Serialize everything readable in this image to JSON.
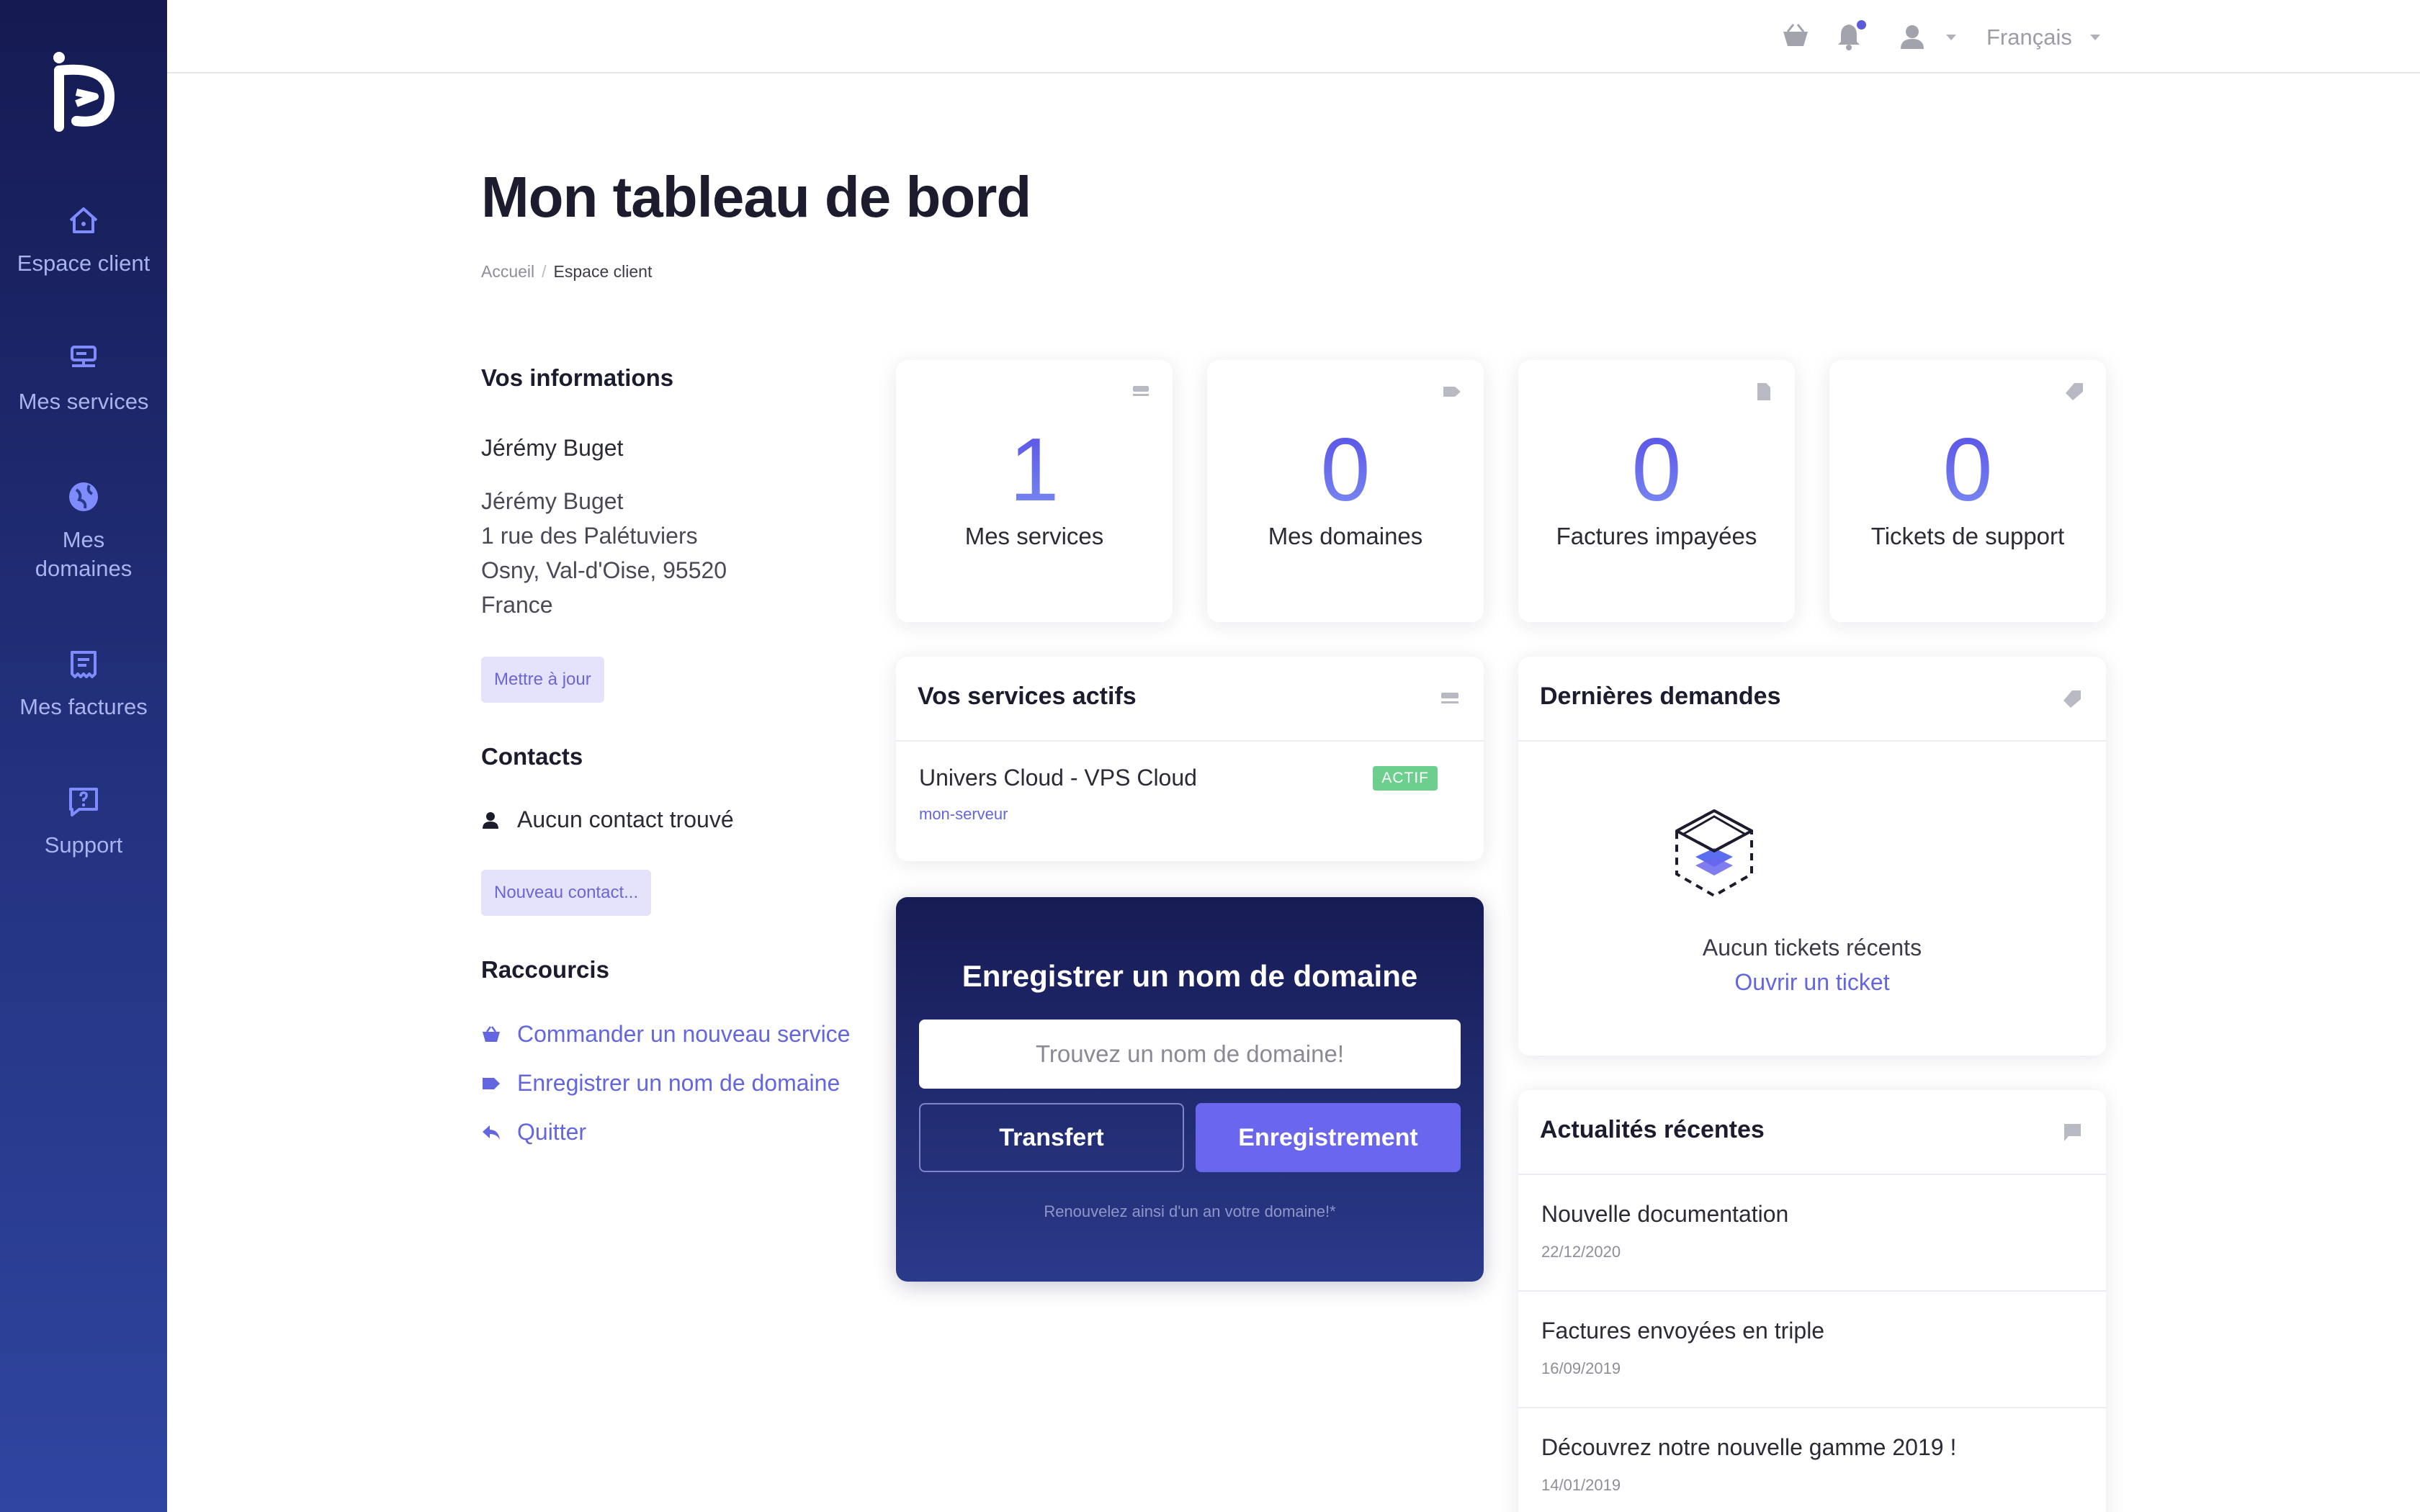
{
  "colors": {
    "sidebar_top": "#151a52",
    "sidebar_bottom": "#2f45a0",
    "accent": "#6366e0",
    "badge_green": "#6ccf8e"
  },
  "sidebar": {
    "items": [
      {
        "label": "Espace client",
        "icon": "home-icon"
      },
      {
        "label": "Mes services",
        "icon": "server-icon"
      },
      {
        "label": "Mes domaines",
        "icon": "globe-icon"
      },
      {
        "label": "Mes factures",
        "icon": "invoice-icon"
      },
      {
        "label": "Support",
        "icon": "support-chat-icon"
      }
    ]
  },
  "header": {
    "language": "Français"
  },
  "page": {
    "title": "Mon tableau de bord",
    "breadcrumb": {
      "home": "Accueil",
      "current": "Espace client"
    }
  },
  "info": {
    "title": "Vos informations",
    "name": "Jérémy Buget",
    "address_lines": [
      "Jérémy Buget",
      "1 rue des Palétuviers",
      "Osny, Val-d'Oise, 95520",
      "France"
    ],
    "update_button": "Mettre à jour"
  },
  "contacts": {
    "title": "Contacts",
    "empty": "Aucun contact trouvé",
    "new_button": "Nouveau contact..."
  },
  "shortcuts": {
    "title": "Raccourcis",
    "items": [
      {
        "label": "Commander un nouveau service",
        "icon": "basket-icon"
      },
      {
        "label": "Enregistrer un nom de domaine",
        "icon": "tag-icon"
      },
      {
        "label": "Quitter",
        "icon": "logout-arrow-icon"
      }
    ]
  },
  "stats": [
    {
      "value": "1",
      "label": "Mes services",
      "icon": "server-icon"
    },
    {
      "value": "0",
      "label": "Mes domaines",
      "icon": "tag-icon"
    },
    {
      "value": "0",
      "label": "Factures impayées",
      "icon": "file-icon"
    },
    {
      "value": "0",
      "label": "Tickets de support",
      "icon": "ticket-icon"
    }
  ],
  "active_services": {
    "title": "Vos services actifs",
    "items": [
      {
        "name": "Univers Cloud - VPS Cloud",
        "host": "mon-serveur",
        "status": "ACTIF"
      }
    ]
  },
  "domain": {
    "title": "Enregistrer un nom de domaine",
    "placeholder": "Trouvez un nom de domaine!",
    "transfer_button": "Transfert",
    "register_button": "Enregistrement",
    "note": "Renouvelez ainsi d'un an votre domaine!*"
  },
  "tickets": {
    "title": "Dernières demandes",
    "empty": "Aucun tickets récents",
    "open_link": "Ouvrir un ticket"
  },
  "news": {
    "title": "Actualités récentes",
    "items": [
      {
        "title": "Nouvelle documentation",
        "date": "22/12/2020"
      },
      {
        "title": "Factures envoyées en triple",
        "date": "16/09/2019"
      },
      {
        "title": "Découvrez notre nouvelle gamme 2019 !",
        "date": "14/01/2019"
      }
    ]
  }
}
